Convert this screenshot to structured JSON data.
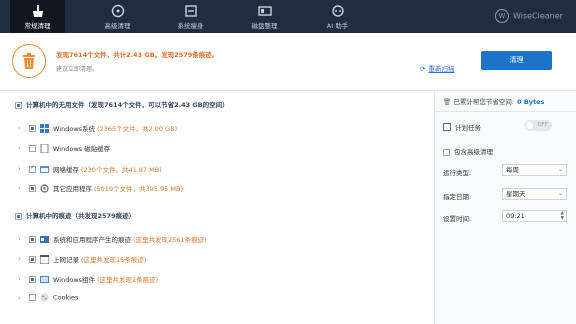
{
  "nav": {
    "tabs": [
      {
        "label": "常规清理",
        "icon": "broom-icon"
      },
      {
        "label": "高级清理",
        "icon": "disk-clean-icon"
      },
      {
        "label": "系统瘦身",
        "icon": "slim-icon"
      },
      {
        "label": "磁盘整理",
        "icon": "defrag-icon"
      },
      {
        "label": "AI 助手",
        "icon": "ai-icon"
      }
    ],
    "brand": "WiseCleaner",
    "brand_logo": "W"
  },
  "summary": {
    "main": "发现7614个文件，共计2.43 GB。发现2579条痕迹。",
    "sub": "建议立即清理。",
    "rescan": "重新扫描",
    "clean_button": "清理"
  },
  "files_section": {
    "title": "计算机中的无用文件（发现7614个文件，可以节省2.43 GB的空间）",
    "items": [
      {
        "label": "Windows系统",
        "detail": "(2365个文件，共2.00 GB)"
      },
      {
        "label": "Windows 磁贴缓存",
        "detail": ""
      },
      {
        "label": "网络缓存",
        "detail": "(230个文件，共41.87 MB)"
      },
      {
        "label": "其它应用程序",
        "detail": "(5019个文件，共395.95 MB)"
      }
    ]
  },
  "traces_section": {
    "title": "计算机中的痕迹（共发现2579痕迹）",
    "items": [
      {
        "label": "系统和应用程序产生的痕迹",
        "detail": "(这里共发现2561条痕迹)"
      },
      {
        "label": "上网记录",
        "detail": "(这里共发现16条痕迹)"
      },
      {
        "label": "Windows组件",
        "detail": "(这里共发现2条痕迹)"
      },
      {
        "label": "Cookies",
        "detail": ""
      }
    ]
  },
  "sidebar": {
    "saved_label": "已累计帮您节省空间:",
    "saved_value": "0 Bytes",
    "schedule_label": "计划任务",
    "toggle_state": "OFF",
    "advanced_label": "包含高级清理",
    "run_type_label": "运行类型:",
    "run_type_value": "每周",
    "day_label": "指定日期:",
    "day_value": "星期天",
    "time_label": "设置时间:",
    "time_value": "09:21"
  },
  "colors": {
    "topbar": "#1f2d3f",
    "accent": "#1c73c9",
    "warning": "#e0702a"
  }
}
